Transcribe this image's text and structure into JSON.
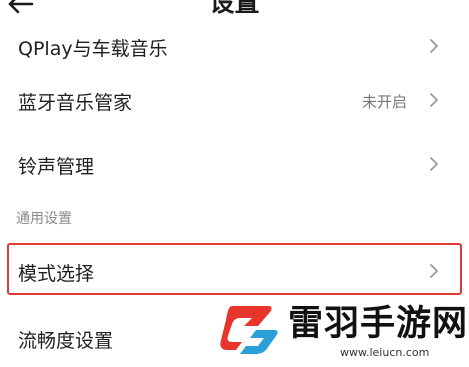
{
  "header": {
    "title": "设置",
    "back_icon": "arrow-left-icon"
  },
  "rows": [
    {
      "label": "QPlay与车载音乐",
      "value": ""
    },
    {
      "label": "蓝牙音乐管家",
      "value": "未开启"
    },
    {
      "label": "铃声管理",
      "value": ""
    }
  ],
  "section": {
    "label": "通用设置"
  },
  "rows_general": [
    {
      "label": "模式选择",
      "value": ""
    },
    {
      "label": "流畅度设置",
      "value": ""
    }
  ],
  "watermark": {
    "name": "雷羽手游网",
    "url": "www.leiucn.com"
  },
  "colors": {
    "highlight": "#e23a33",
    "logo_red": "#e8352c",
    "logo_blue": "#2a9fd8"
  }
}
